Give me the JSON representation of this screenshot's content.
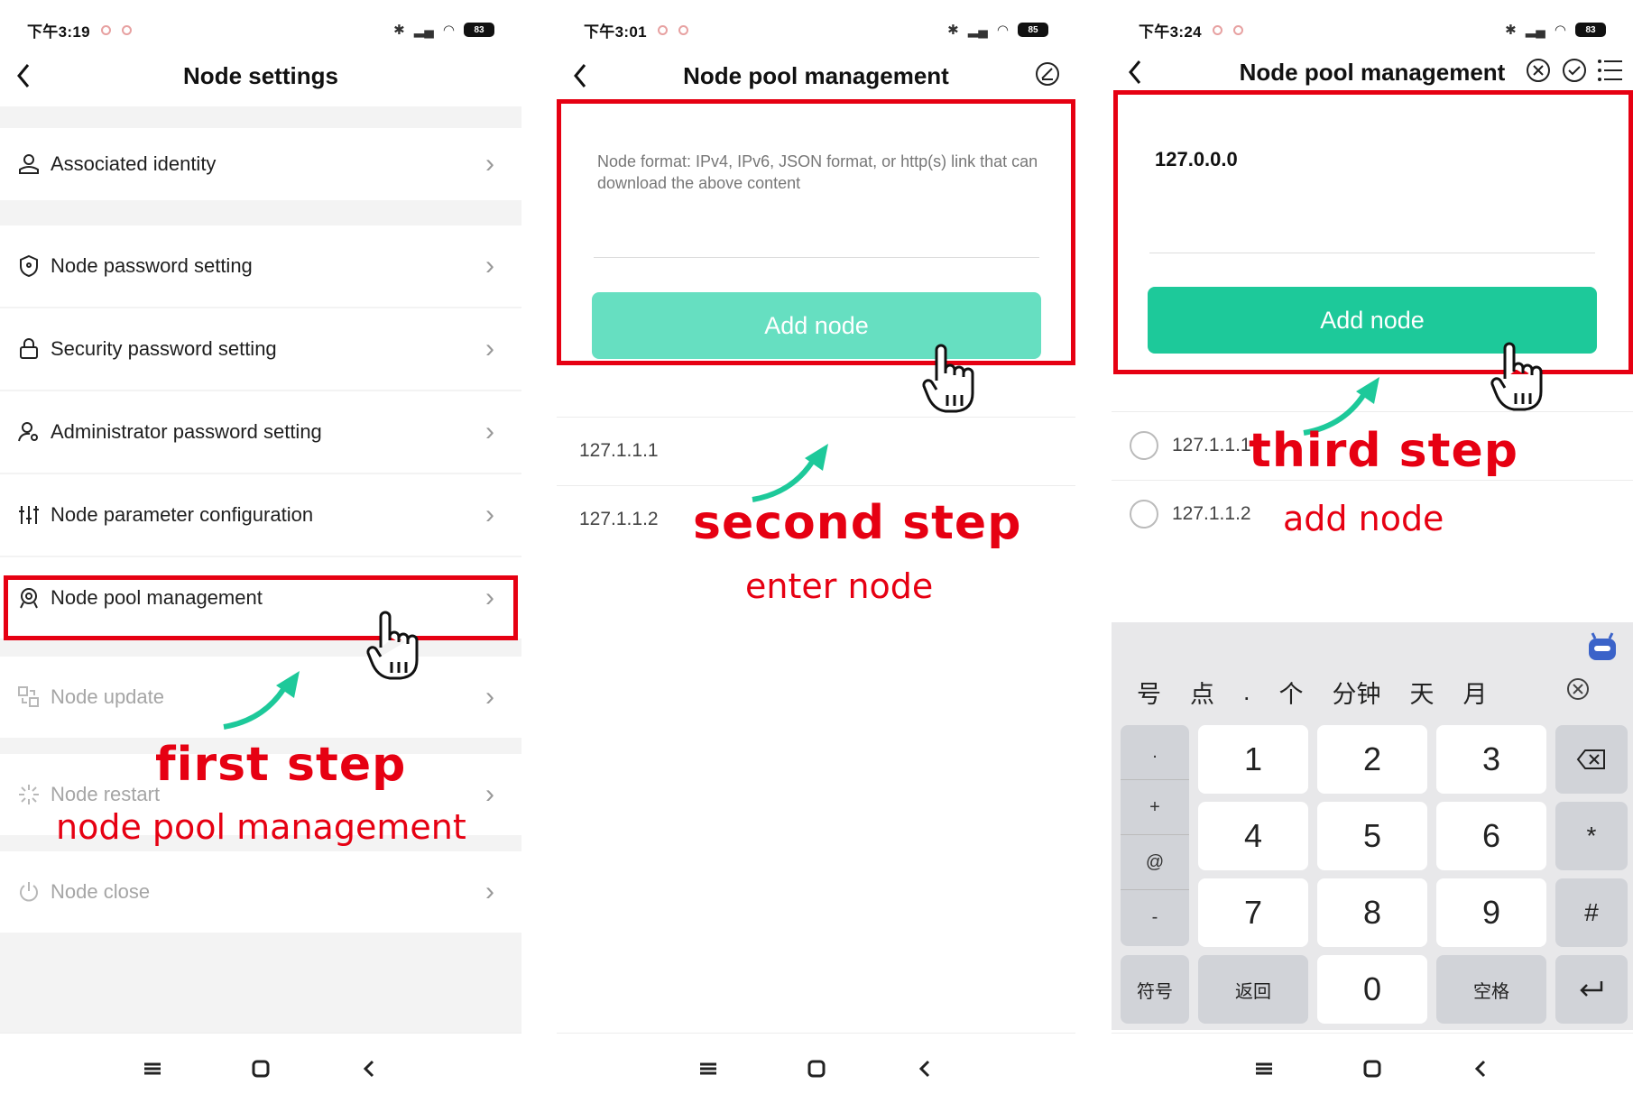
{
  "panel1": {
    "status_time": "下午3:19",
    "battery": "83",
    "title": "Node settings",
    "items": [
      {
        "label": "Associated identity",
        "icon": "person-icon",
        "enabled": true
      },
      {
        "label": "Node password setting",
        "icon": "shield-icon",
        "enabled": true
      },
      {
        "label": "Security password setting",
        "icon": "lock-icon",
        "enabled": true
      },
      {
        "label": "Administrator password setting",
        "icon": "admin-icon",
        "enabled": true
      },
      {
        "label": "Node parameter configuration",
        "icon": "sliders-icon",
        "enabled": true
      },
      {
        "label": "Node pool management",
        "icon": "badge-icon",
        "enabled": true
      },
      {
        "label": "Node update",
        "icon": "update-icon",
        "enabled": false
      },
      {
        "label": "Node restart",
        "icon": "loading-icon",
        "enabled": false
      },
      {
        "label": "Node close",
        "icon": "power-icon",
        "enabled": false
      }
    ],
    "annotation_title": "first step",
    "annotation_sub": "node pool management"
  },
  "panel2": {
    "status_time": "下午3:01",
    "battery": "85",
    "title": "Node pool management",
    "placeholder": "Node format: IPv4, IPv6, JSON format, or http(s) link that can download the above content",
    "add_button": "Add node",
    "nodes": [
      "127.1.1.1",
      "127.1.1.2"
    ],
    "annotation_title": "second step",
    "annotation_sub": "enter node"
  },
  "panel3": {
    "status_time": "下午3:24",
    "battery": "83",
    "title": "Node pool management",
    "input_value": "127.0.0.0",
    "add_button": "Add node",
    "nodes": [
      "127.1.1.1",
      "127.1.1.2"
    ],
    "annotation_title": "third step",
    "annotation_sub": "add node",
    "keyboard": {
      "suggestions": [
        "号",
        "点",
        ".",
        "个",
        "分钟",
        "天",
        "月"
      ],
      "side_keys": [
        ".",
        "+",
        "@",
        "-"
      ],
      "digits": [
        "1",
        "2",
        "3",
        "4",
        "5",
        "6",
        "7",
        "8",
        "9",
        "0"
      ],
      "symbols_key": "符号",
      "return_key": "返回",
      "space_key": "空格",
      "star_key": "*",
      "hash_key": "#"
    }
  },
  "colors": {
    "accent": "#1dc99a",
    "accent_light": "#66dfc1",
    "highlight": "#e60012",
    "annotation": "#e60012"
  }
}
